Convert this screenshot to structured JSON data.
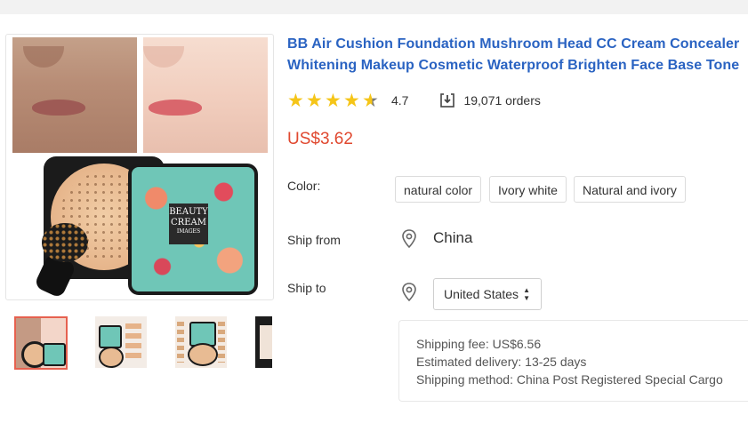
{
  "product": {
    "title": "BB Air Cushion Foundation Mushroom Head CC Cream Concealer Whitening Makeup Cosmetic Waterproof Brighten Face Base Tone",
    "rating": "4.7",
    "rating_value": 4.7,
    "orders": "19,071 orders",
    "price": "US$3.62",
    "image_text": {
      "brand_line1": "BEAUTY",
      "brand_line2": "CREAM",
      "brand_line3": "IMAGES"
    }
  },
  "options": {
    "color_label": "Color:",
    "colors": [
      "natural color",
      "Ivory white",
      "Natural and ivory"
    ]
  },
  "shipping": {
    "ship_from_label": "Ship from",
    "ship_from_value": "China",
    "ship_to_label": "Ship to",
    "ship_to_value": "United States",
    "fee": "Shipping fee: US$6.56",
    "delivery": "Estimated delivery: 13-25 days",
    "method": "Shipping method: China Post Registered Special Cargo"
  },
  "colors": {
    "title_blue": "#2a63c2",
    "price_red": "#e0482f",
    "star_gold": "#f5c518",
    "thumb_selected": "#e6614f"
  },
  "icons": [
    "star-icon",
    "orders-download-icon",
    "location-pin-icon",
    "select-caret-icon"
  ]
}
